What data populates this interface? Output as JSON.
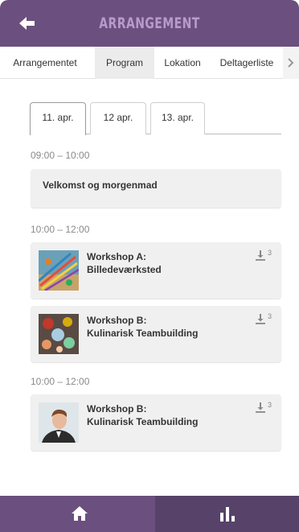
{
  "header": {
    "title": "ARRANGEMENT",
    "back_icon": "arrow-left-icon"
  },
  "tabs": [
    {
      "label": "Arrangementet"
    },
    {
      "label": "Program"
    },
    {
      "label": "Lokation"
    },
    {
      "label": "Deltagerliste"
    }
  ],
  "tabs_more_icon": "chevron-right-icon",
  "days": [
    {
      "label": "11. apr."
    },
    {
      "label": "12 apr."
    },
    {
      "label": "13. apr."
    }
  ],
  "schedule": [
    {
      "time": "09:00 – 10:00",
      "title": "Velkomst og morgenmad"
    },
    {
      "time": "10:00 – 12:00",
      "title": "Workshop A:\nBilledeværksted",
      "downloads": "3"
    },
    {
      "title": "Workshop B:\nKulinarisk Teambuilding",
      "downloads": "3"
    },
    {
      "time": "10:00 – 12:00",
      "title": "Workshop B:\nKulinarisk Teambuilding",
      "downloads": "3"
    }
  ],
  "bottom_nav": {
    "home_icon": "home-icon",
    "stats_icon": "bar-chart-icon"
  },
  "colors": {
    "header": "#6b4f7e",
    "header_title": "#b89bc9",
    "nav_left": "#6b4f7e",
    "nav_right": "#57436a"
  }
}
